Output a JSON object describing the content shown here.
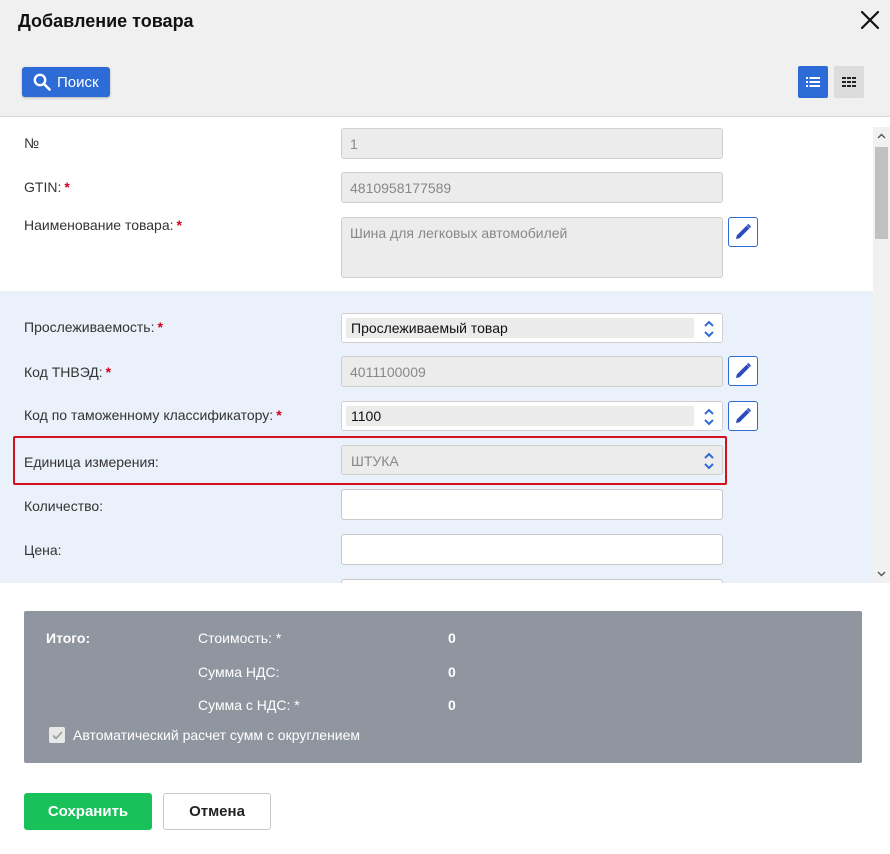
{
  "dialog": {
    "title": "Добавление товара",
    "close_icon": "close-icon"
  },
  "toolbar": {
    "search_label": "Поиск",
    "search_icon": "search-icon",
    "list_view_icon": "list-view-icon",
    "grid_view_icon": "grid-view-icon"
  },
  "form": {
    "number": {
      "label": "№",
      "value": "1"
    },
    "gtin": {
      "label": "GTIN:",
      "required": "*",
      "value": "4810958177589"
    },
    "name": {
      "label": "Наименование товара:",
      "required": "*",
      "value": "Шина для легковых автомобилей"
    },
    "traceability": {
      "label": "Прослеживаемость:",
      "required": "*",
      "value": "Прослеживаемый товар"
    },
    "tnved": {
      "label": "Код ТНВЭД:",
      "required": "*",
      "value": "4011100009"
    },
    "customs_code": {
      "label": "Код по таможенному классификатору:",
      "required": "*",
      "value": "1100"
    },
    "unit": {
      "label": "Единица измерения:",
      "value": "ШТУКА"
    },
    "quantity": {
      "label": "Количество:",
      "value": ""
    },
    "price": {
      "label": "Цена:",
      "value": ""
    }
  },
  "totals": {
    "heading": "Итого:",
    "cost_label": "Стоимость: *",
    "cost_value": "0",
    "vat_label": "Сумма НДС:",
    "vat_value": "0",
    "with_vat_label": "Сумма с НДС: *",
    "with_vat_value": "0",
    "auto_calc_label": "Автоматический расчет сумм с округлением",
    "auto_calc_checked": true
  },
  "actions": {
    "save_label": "Сохранить",
    "cancel_label": "Отмена"
  },
  "colors": {
    "accent": "#2d6bd6",
    "save": "#18c15a",
    "highlight": "#d4111c",
    "required": "#d0021b",
    "totals_bg": "#9096a0"
  }
}
